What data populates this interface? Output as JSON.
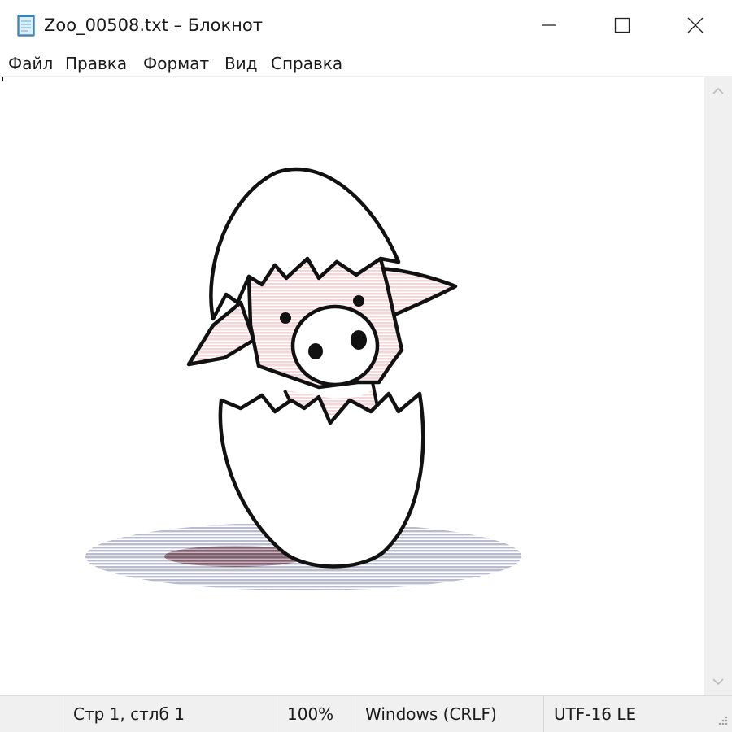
{
  "window": {
    "title": "Zoo_00508.txt – Блокнот",
    "icon": "notepad-icon",
    "controls": [
      "minimize-icon",
      "maximize-icon",
      "close-icon"
    ]
  },
  "menu": {
    "items": [
      "Файл",
      "Правка",
      "Формат",
      "Вид",
      "Справка"
    ]
  },
  "editor": {
    "content_icon": "hatching-pig-ascii-art"
  },
  "status": {
    "position": "Стр 1, стлб 1",
    "zoom": "100%",
    "line_ending": "Windows (CRLF)",
    "encoding": "UTF-16 LE"
  },
  "colors": {
    "pig_pink": "#f6dede",
    "shadow_outer": "#b9bccf",
    "shadow_inner": "#8a6b78",
    "outline": "#111111"
  }
}
